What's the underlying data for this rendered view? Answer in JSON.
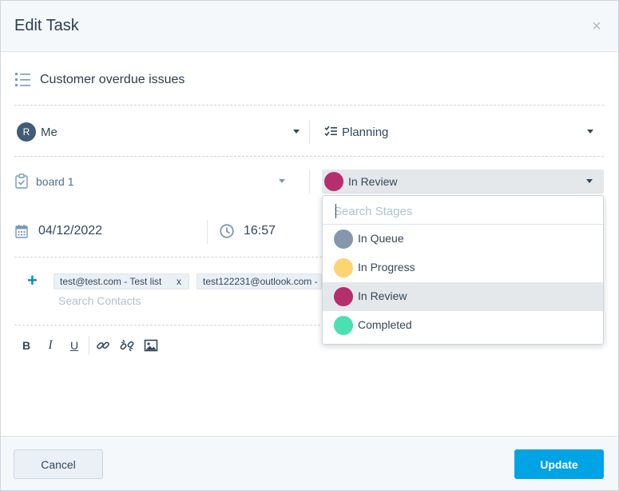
{
  "dialog": {
    "title": "Edit Task",
    "close_glyph": "×"
  },
  "task": {
    "title": "Customer overdue issues"
  },
  "assignee": {
    "avatar_initial": "R",
    "value": "Me"
  },
  "type": {
    "value": "Planning"
  },
  "board": {
    "value": "board 1"
  },
  "stage": {
    "value": "In Review",
    "color": "#b52f6e",
    "search_placeholder": "Search Stages",
    "options": [
      {
        "label": "In Queue",
        "color": "#8497ab"
      },
      {
        "label": "In Progress",
        "color": "#fcd572"
      },
      {
        "label": "In Review",
        "color": "#b52f6e"
      },
      {
        "label": "Completed",
        "color": "#4be0b1"
      }
    ]
  },
  "due": {
    "date": "04/12/2022",
    "time": "16:57"
  },
  "contacts": {
    "chips": [
      {
        "label": "test@test.com - Test list",
        "remove": "x"
      },
      {
        "label": "test122231@outlook.com -",
        "remove": ""
      }
    ],
    "placeholder": "Search Contacts"
  },
  "editor": {
    "bold": "B",
    "italic": "I",
    "underline": "U"
  },
  "footer": {
    "cancel_label": "Cancel",
    "update_label": "Update"
  },
  "colors": {
    "accent": "#00a4e4",
    "plus": "#0091ae",
    "text": "#33475b"
  }
}
